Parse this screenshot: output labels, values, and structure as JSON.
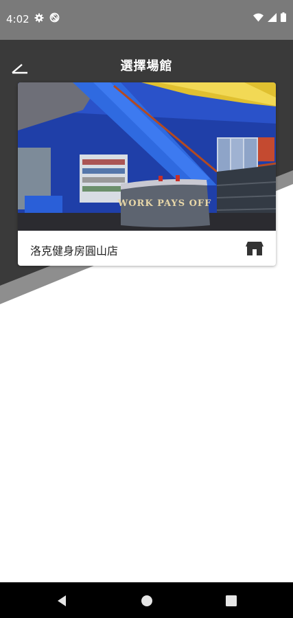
{
  "status_bar": {
    "time": "4:02",
    "left_icons": [
      "gear-icon",
      "no-sync-icon"
    ],
    "right_icons": [
      "wifi-icon",
      "cell-signal-icon",
      "battery-icon"
    ]
  },
  "header": {
    "title": "選擇場館",
    "back_icon": "back-arrow-icon"
  },
  "venues": [
    {
      "name": "洛克健身房圓山店",
      "photo_text": "WORK PAYS OFF",
      "icon": "store-icon"
    }
  ],
  "colors": {
    "status_bar": "#7a7a7a",
    "header_dark": "#3a3a3a",
    "header_stripe": "#8e8e8e",
    "nav_bar": "#000000"
  },
  "nav_bar": {
    "icons": [
      "back-triangle-icon",
      "home-circle-icon",
      "recents-square-icon"
    ]
  }
}
